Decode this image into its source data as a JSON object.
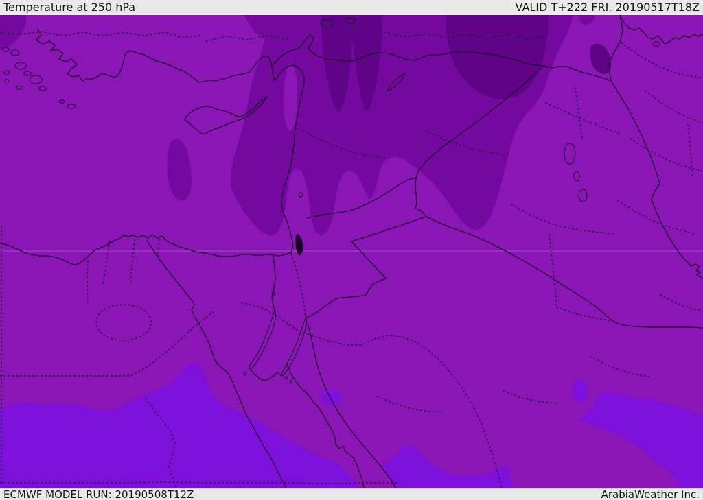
{
  "header": {
    "title": "Temperature at 250 hPa",
    "valid_label": "VALID T+222 FRI. 20190517T18Z"
  },
  "footer": {
    "model_run_label": "ECMWF MODEL RUN: 20190508T12Z",
    "brand_label": "ArabiaWeather Inc."
  },
  "map": {
    "type": "weather-forecast-map",
    "parameter": "Temperature at 250 hPa",
    "region": "Middle East / Eastern Mediterranean",
    "visible_features": [
      "coastlines",
      "country borders",
      "dotted admin borders",
      "Nile river",
      "Red Sea coasts",
      "Cyprus",
      "lakes",
      "latitude graticule line"
    ],
    "colors": {
      "band_main": "#8a16b6",
      "band_dark": "#73099f",
      "band_darkest": "#5f0487",
      "band_bright": "#7d10da",
      "border_line": "#1c0126",
      "graticule": "#a76bc8",
      "chrome_bg": "#e9e9e9",
      "chrome_text": "#141414"
    }
  }
}
